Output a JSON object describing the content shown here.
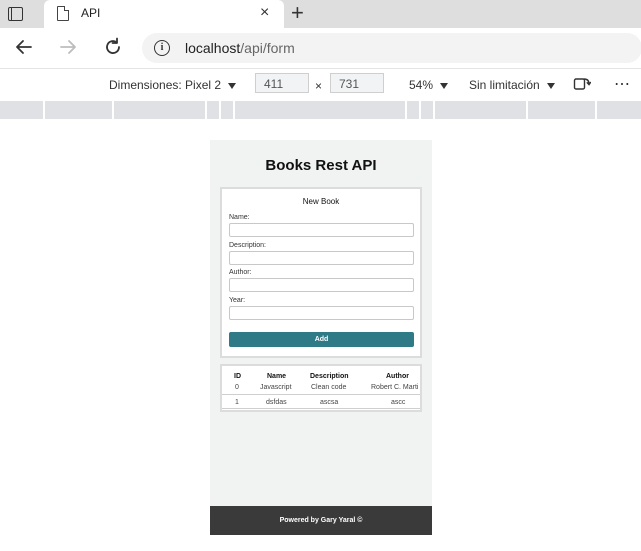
{
  "browser": {
    "tab_title": "API",
    "tab_close": "×",
    "new_tab": "+",
    "url_host": "localhost",
    "url_path": "/api/form"
  },
  "device_toolbar": {
    "dimensions_label": "Dimensiones: Pixel 2",
    "width": "411",
    "times": "×",
    "height": "731",
    "zoom": "54%",
    "throttle": "Sin limitación",
    "more": "⋯"
  },
  "app": {
    "title": "Books Rest API",
    "form": {
      "title": "New Book",
      "name_label": "Name:",
      "description_label": "Description:",
      "author_label": "Author:",
      "year_label": "Year:",
      "add_button": "Add"
    },
    "table": {
      "headers": [
        "ID",
        "Name",
        "Description",
        "Author"
      ],
      "rows": [
        [
          "0",
          "Javascript",
          "Clean code",
          "Robert C. Marti"
        ],
        [
          "1",
          "dsfdas",
          "ascsa",
          "ascc"
        ]
      ]
    },
    "footer": "Powered by Gary Yaral ©"
  },
  "icons": [
    "tab-actions-icon",
    "page-icon",
    "close-icon",
    "new-tab-icon",
    "back-arrow-icon",
    "forward-arrow-icon",
    "refresh-icon",
    "info-icon",
    "caret-down-icon",
    "rotate-icon",
    "more-icon"
  ]
}
